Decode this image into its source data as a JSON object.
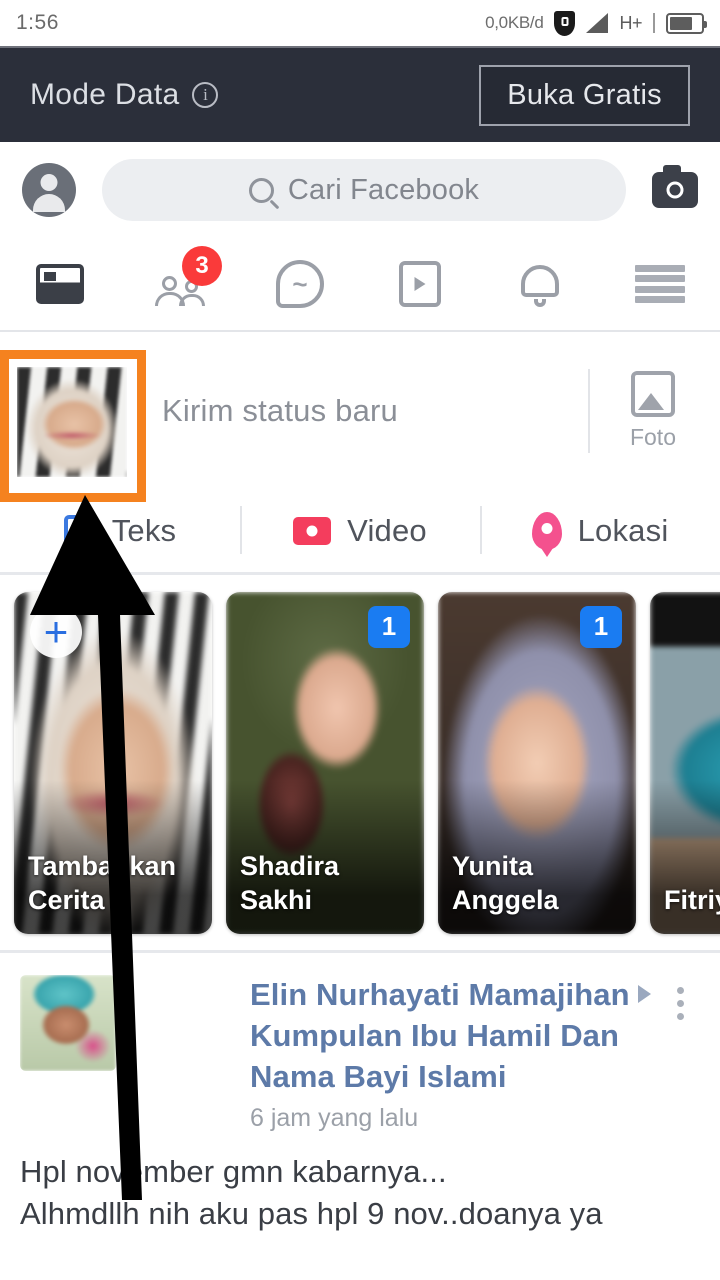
{
  "status_bar": {
    "time": "1:56",
    "network_speed": "0,0KB/d",
    "network_type": "H+",
    "icons": [
      "shield-icon",
      "signal-icon",
      "battery-icon"
    ]
  },
  "data_mode_bar": {
    "label": "Mode Data",
    "info_icon": "info-icon",
    "button_label": "Buka Gratis",
    "background_color": "#2b2f3a"
  },
  "search": {
    "placeholder": "Cari Facebook",
    "search_icon": "search-icon",
    "profile_icon": "profile-avatar-icon",
    "camera_icon": "camera-icon"
  },
  "nav_tabs": [
    {
      "name": "news-feed",
      "icon": "news-feed-icon",
      "active": true,
      "badge": ""
    },
    {
      "name": "friends",
      "icon": "friends-icon",
      "active": false,
      "badge": "3"
    },
    {
      "name": "messenger",
      "icon": "messenger-icon",
      "active": false,
      "badge": ""
    },
    {
      "name": "watch",
      "icon": "watch-video-icon",
      "active": false,
      "badge": ""
    },
    {
      "name": "notifications",
      "icon": "bell-icon",
      "active": false,
      "badge": ""
    },
    {
      "name": "menu",
      "icon": "hamburger-menu-icon",
      "active": false,
      "badge": ""
    }
  ],
  "composer": {
    "placeholder": "Kirim status baru",
    "photo_label": "Foto",
    "photo_icon": "photo-icon"
  },
  "composer_actions": [
    {
      "label": "Teks",
      "icon": "text-icon",
      "color": "#3b79e0"
    },
    {
      "label": "Video",
      "icon": "video-icon",
      "color": "#f43d5d"
    },
    {
      "label": "Lokasi",
      "icon": "location-pin-icon",
      "color": "#f4518e"
    }
  ],
  "stories": [
    {
      "name": "Tambahkan Cerita",
      "badge": "",
      "add": true,
      "photo": "ph-hijab1"
    },
    {
      "name": "Shadira Sakhi",
      "badge": "1",
      "add": false,
      "photo": "ph-couple"
    },
    {
      "name": "Yunita Anggela",
      "badge": "1",
      "add": false,
      "photo": "ph-yunita"
    },
    {
      "name": "Fitriy",
      "badge": "",
      "add": false,
      "photo": "ph-group"
    }
  ],
  "post": {
    "author": "Elin Nurhayati Mamajihan",
    "group": "Kumpulan Ibu Hamil Dan Nama Bayi Islami",
    "timestamp": "6 jam yang lalu",
    "menu_icon": "more-options-icon",
    "body_line1": "Hpl november gmn kabarnya...",
    "body_line2": "Alhmdllh nih aku pas hpl 9 nov..doanya ya"
  },
  "annotation": {
    "highlight_color": "#f5821f",
    "arrow_color": "#000000",
    "target": "composer-profile-avatar"
  }
}
